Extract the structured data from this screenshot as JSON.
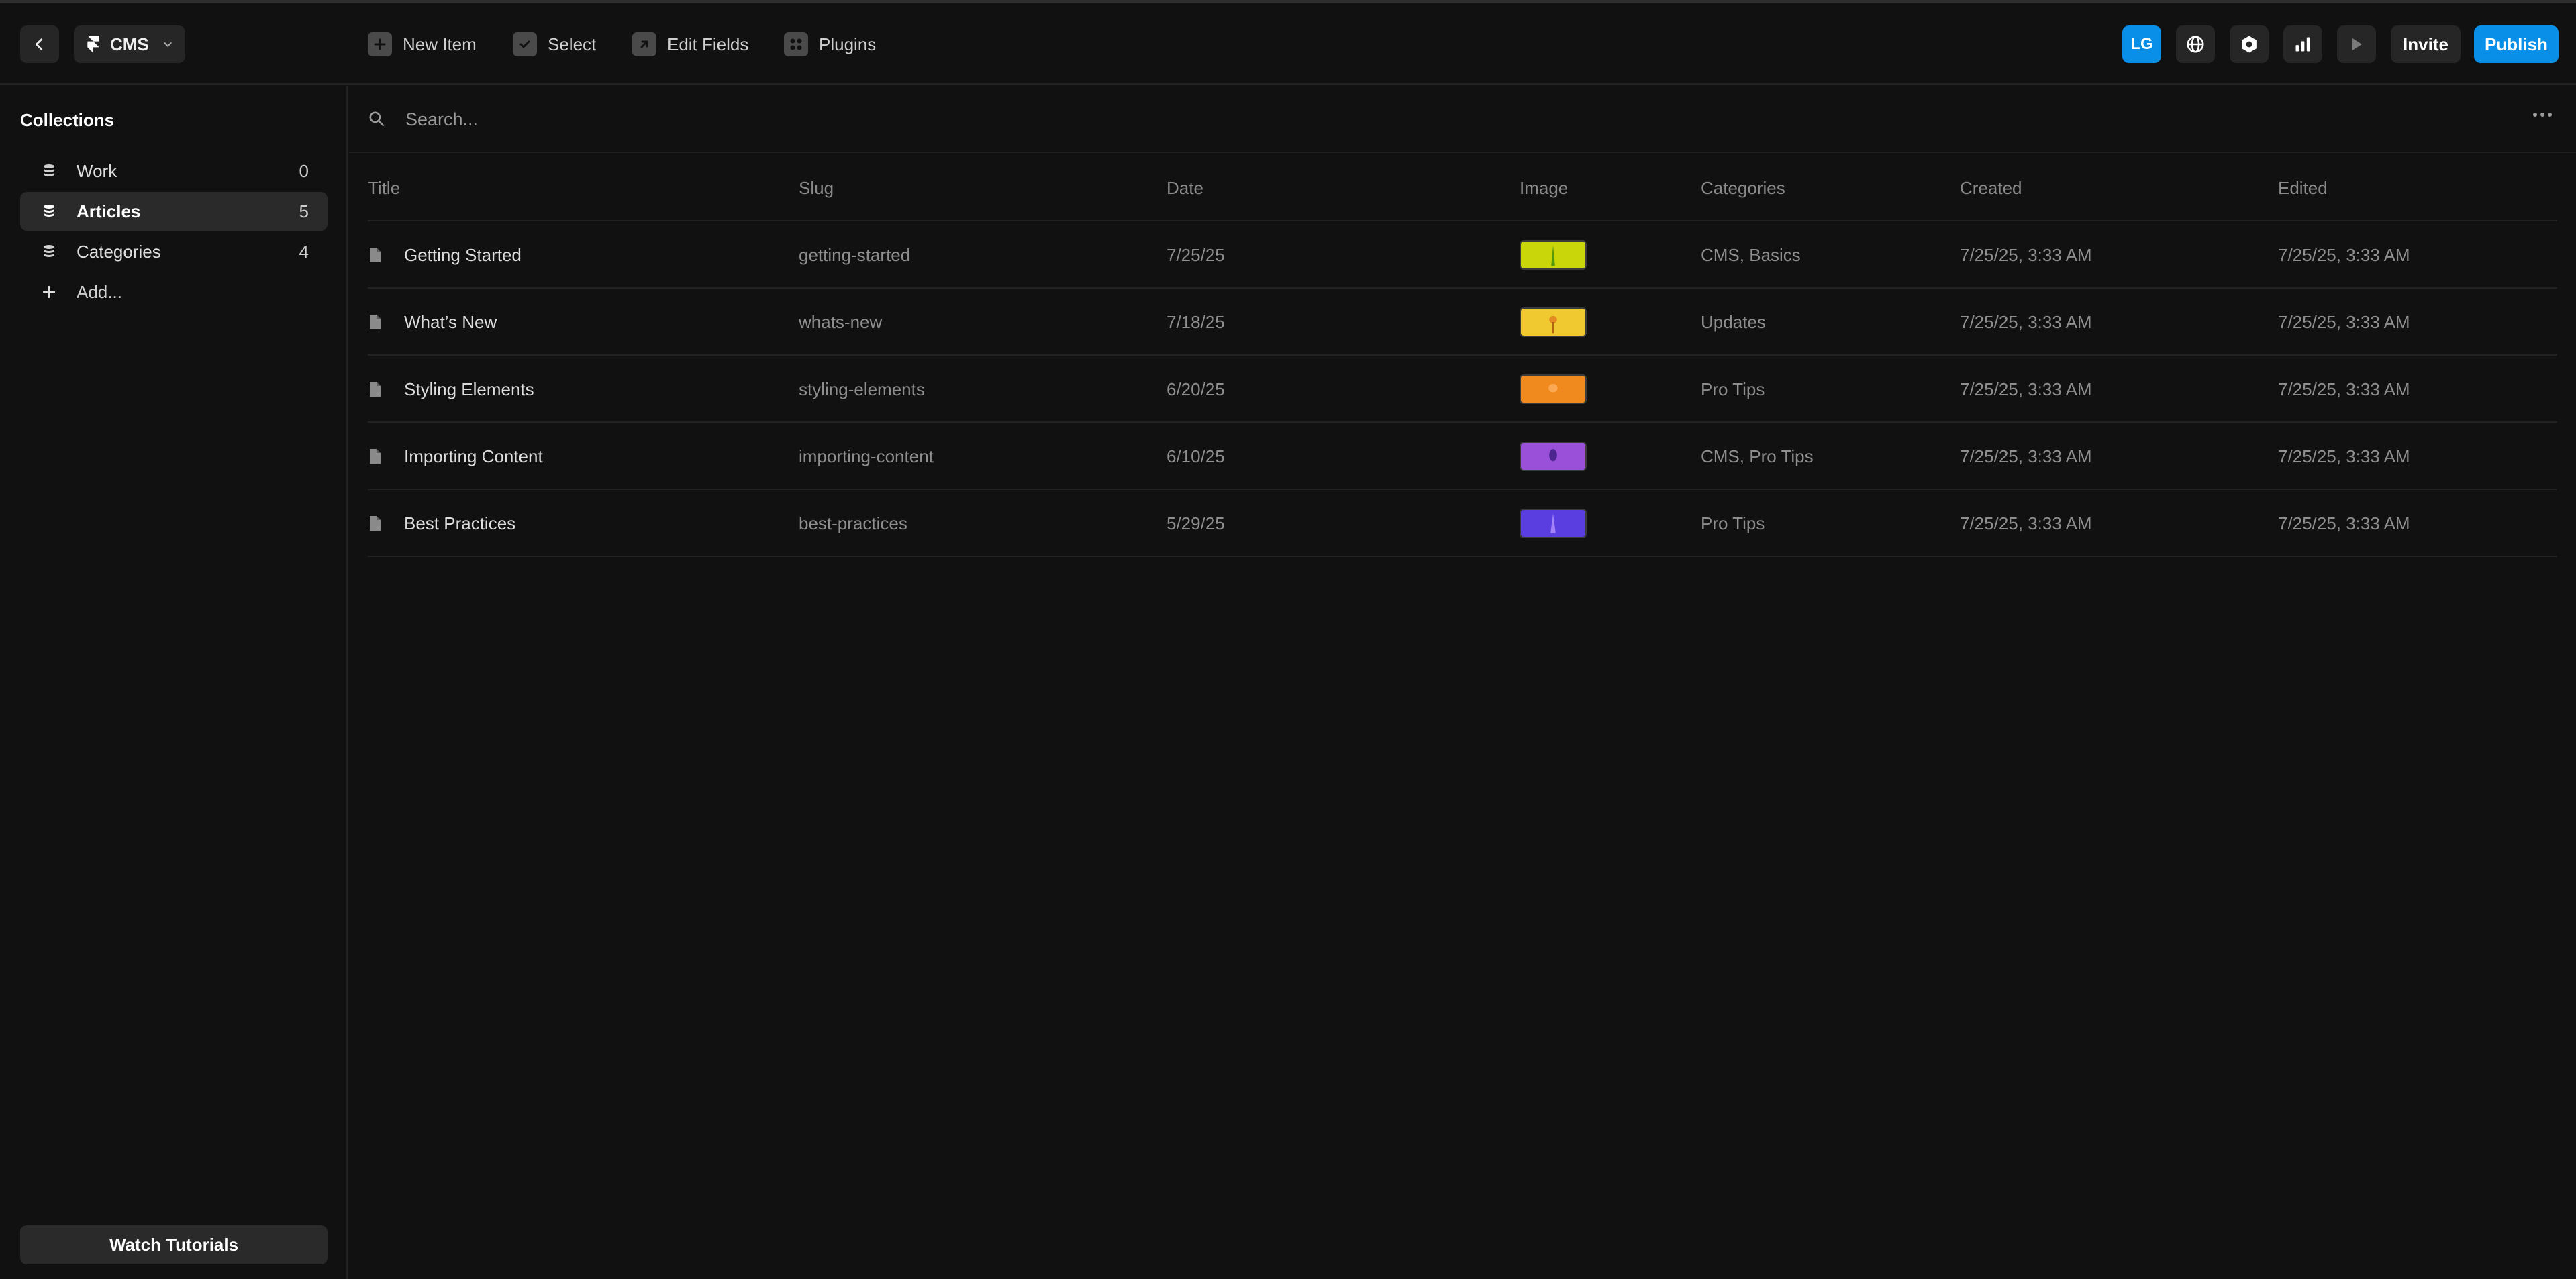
{
  "topbar": {
    "project_name": "CMS",
    "tools": {
      "new_item": "New Item",
      "select": "Select",
      "edit_fields": "Edit Fields",
      "plugins": "Plugins"
    },
    "avatar_initials": "LG",
    "invite_label": "Invite",
    "publish_label": "Publish"
  },
  "sidebar": {
    "heading": "Collections",
    "items": [
      {
        "label": "Work",
        "count": "0"
      },
      {
        "label": "Articles",
        "count": "5"
      },
      {
        "label": "Categories",
        "count": "4"
      }
    ],
    "add_label": "Add...",
    "tutorials_label": "Watch Tutorials"
  },
  "search": {
    "placeholder": "Search..."
  },
  "table": {
    "columns": {
      "title": "Title",
      "slug": "Slug",
      "date": "Date",
      "image": "Image",
      "categories": "Categories",
      "created": "Created",
      "edited": "Edited"
    },
    "rows": [
      {
        "title": "Getting Started",
        "slug": "getting-started",
        "date": "7/25/25",
        "categories": "CMS, Basics",
        "created": "7/25/25, 3:33 AM",
        "edited": "7/25/25, 3:33 AM",
        "thumb_color": "#c9d60a"
      },
      {
        "title": "What’s New",
        "slug": "whats-new",
        "date": "7/18/25",
        "categories": "Updates",
        "created": "7/25/25, 3:33 AM",
        "edited": "7/25/25, 3:33 AM",
        "thumb_color": "#f0c830"
      },
      {
        "title": "Styling Elements",
        "slug": "styling-elements",
        "date": "6/20/25",
        "categories": "Pro Tips",
        "created": "7/25/25, 3:33 AM",
        "edited": "7/25/25, 3:33 AM",
        "thumb_color": "#f08a1e"
      },
      {
        "title": "Importing Content",
        "slug": "importing-content",
        "date": "6/10/25",
        "categories": "CMS, Pro Tips",
        "created": "7/25/25, 3:33 AM",
        "edited": "7/25/25, 3:33 AM",
        "thumb_color": "#9a50d8"
      },
      {
        "title": "Best Practices",
        "slug": "best-practices",
        "date": "5/29/25",
        "categories": "Pro Tips",
        "created": "7/25/25, 3:33 AM",
        "edited": "7/25/25, 3:33 AM",
        "thumb_color": "#5a3ee0"
      }
    ]
  },
  "colors": {
    "accent": "#0a8fe8",
    "background": "#111111",
    "surface": "#262626"
  }
}
